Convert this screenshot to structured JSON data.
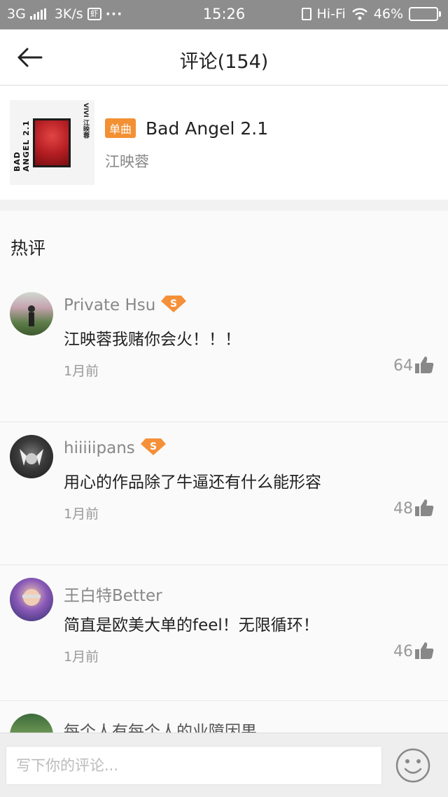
{
  "status_bar": {
    "network": "3G",
    "speed": "3K/s",
    "app_badge": "虾",
    "more": "···",
    "time": "15:26",
    "wifi_label": "Hi-Fi",
    "battery": "46%",
    "battery_level": 0.46
  },
  "header": {
    "title": "评论(154)"
  },
  "song": {
    "tag": "单曲",
    "title": "Bad Angel 2.1",
    "artist": "江映蓉",
    "cover": {
      "side_text": "BAD ANGEL 2.1",
      "top_text": "VIVI 江映蓉"
    }
  },
  "hot_section": {
    "title": "热评",
    "comments": [
      {
        "name": "Private Hsu",
        "vip": true,
        "vip_letter": "S",
        "text": "江映蓉我赌你会火！！！",
        "time": "1月前",
        "likes": "64"
      },
      {
        "name": "hiiiiipans",
        "vip": true,
        "vip_letter": "S",
        "text": "用心的作品除了牛逼还有什么能形容",
        "time": "1月前",
        "likes": "48"
      },
      {
        "name": "王白特Better",
        "vip": false,
        "text": "简直是欧美大单的feel！无限循环！",
        "time": "1月前",
        "likes": "46"
      },
      {
        "name": "每个人有每个人的业障因果",
        "vip": false
      }
    ]
  },
  "input_bar": {
    "placeholder": "写下你的评论..."
  },
  "colors": {
    "accent_orange": "#f39033",
    "vip_orange": "#f5903a",
    "muted_text": "#888888"
  }
}
